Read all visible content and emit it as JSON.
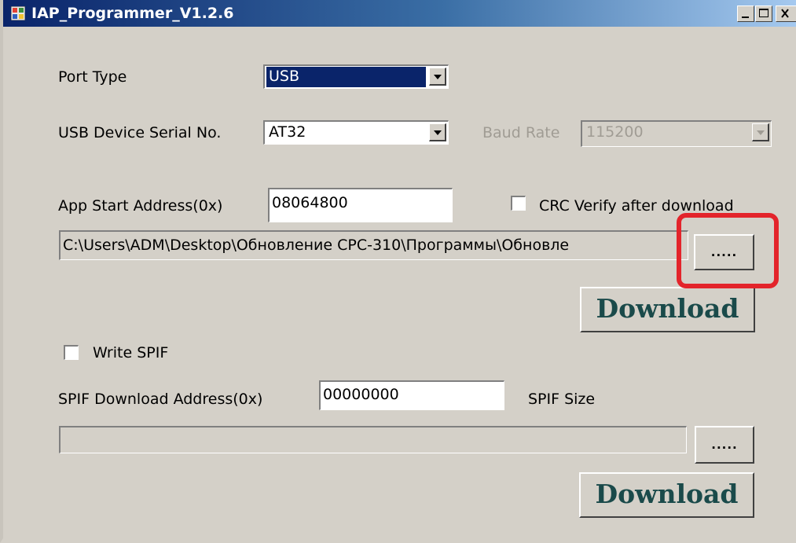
{
  "window": {
    "title": "IAP_Programmer_V1.2.6",
    "controls": {
      "minimize": "minimize-icon",
      "maximize": "maximize-icon",
      "close": "close-icon"
    }
  },
  "port": {
    "label": "Port Type",
    "value": "USB"
  },
  "usb": {
    "label": "USB Device Serial No.",
    "value": "AT32"
  },
  "baud": {
    "label": "Baud Rate",
    "value": "115200"
  },
  "app": {
    "address_label": "App Start Address(0x)",
    "address_value": "08064800",
    "crc_label": "CRC Verify after download",
    "crc_checked": false,
    "file_path": "C:\\Users\\ADM\\Desktop\\Обновление СРС-310\\Программы\\Обновле",
    "browse_label": ".....",
    "download_label": "Download"
  },
  "spif": {
    "write_label": "Write SPIF",
    "write_checked": false,
    "address_label": "SPIF Download Address(0x)",
    "address_value": "00000000",
    "size_label": "SPIF Size",
    "file_path": "",
    "browse_label": ".....",
    "download_label": "Download"
  },
  "colors": {
    "title_bar": "#0a246a",
    "annotation": "#e3242b",
    "face": "#d4d0c8"
  }
}
